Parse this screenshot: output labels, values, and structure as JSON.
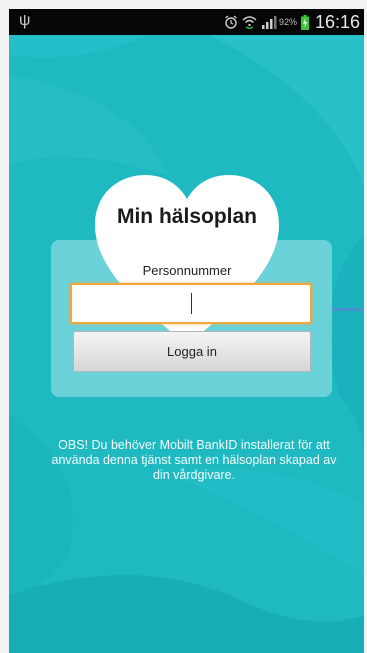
{
  "status_bar": {
    "usb_icon": "usb-icon",
    "alarm_icon": "alarm-icon",
    "wifi_icon": "wifi-icon",
    "signal_icon": "signal-icon",
    "battery_percent": "92%",
    "battery_icon": "battery-icon",
    "time": "16:16"
  },
  "login": {
    "title": "Min hälsoplan",
    "personnummer_label": "Personnummer",
    "personnummer_value": "",
    "login_button": "Logga in"
  },
  "notice": "OBS! Du behöver Mobilt BankID installerat för att använda denna tjänst samt en hälsoplan skapad av din vårdgivare.",
  "colors": {
    "background": "#1fb9c2",
    "status_bar": "#050607",
    "input_focus": "#f0a83a",
    "connector": "#4a8fd0"
  }
}
